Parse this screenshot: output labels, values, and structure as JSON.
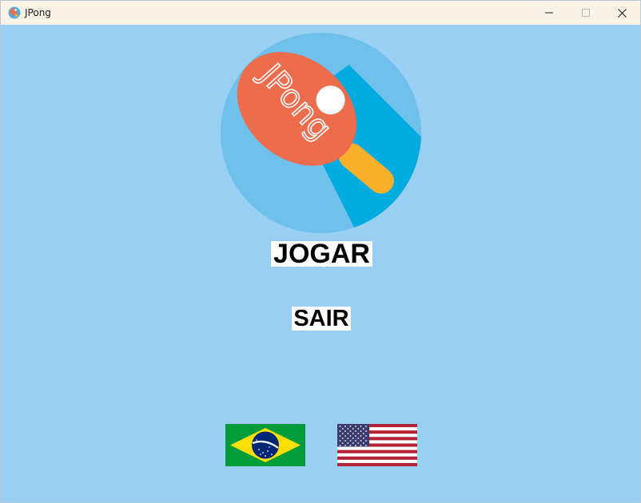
{
  "window": {
    "title": "JPong",
    "app_icon": "ping-pong-paddle-icon",
    "controls": {
      "minimize_icon": "minimize-icon",
      "maximize_icon": "maximize-icon",
      "close_icon": "close-icon"
    }
  },
  "logo": {
    "text": "JPong",
    "icon": "ping-pong-paddle-logo",
    "colors": {
      "circle": "#70c0ec",
      "shadow": "#00acdf",
      "paddle": "#ec6c4c",
      "handle": "#fbb12b",
      "ball": "#ffffff"
    }
  },
  "menu": {
    "play_label": "JOGAR",
    "exit_label": "SAIR"
  },
  "languages": [
    {
      "name": "brazil-flag-icon"
    },
    {
      "name": "usa-flag-icon"
    }
  ],
  "colors": {
    "background": "#99cff2",
    "titlebar": "#fbf3e7"
  }
}
